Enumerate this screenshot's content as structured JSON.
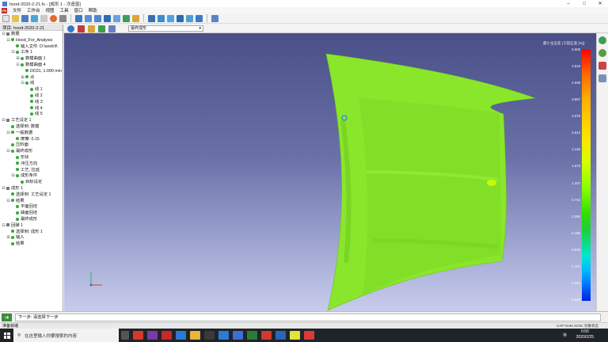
{
  "window": {
    "title": "hood-2020-2-21.fs - [成形 1 - 次造窗]"
  },
  "menu": {
    "logo": "FS",
    "items": [
      "文件",
      "工作台",
      "视图",
      "工具",
      "窗口",
      "帮助"
    ]
  },
  "panel": {
    "header": "项目: hood-2020-2-21",
    "tree": [
      {
        "label": "数据",
        "depth": 0,
        "tw": "⊟",
        "icon": "sq"
      },
      {
        "label": "Hood_For_Analysis",
        "depth": 1,
        "tw": "⊟",
        "icon": "dot"
      },
      {
        "label": "输入文件: D:\\work\\f\\",
        "depth": 2,
        "tw": "",
        "icon": "dot"
      },
      {
        "label": "工序 1",
        "depth": 2,
        "tw": "⊟",
        "icon": "dot"
      },
      {
        "label": "数模曲面 1",
        "depth": 3,
        "tw": "⊞",
        "icon": "dot"
      },
      {
        "label": "数模曲面 4",
        "depth": 3,
        "tw": "⊟",
        "icon": "dot"
      },
      {
        "label": "DC01, 1.000 mm",
        "depth": 4,
        "tw": "",
        "icon": "dot"
      },
      {
        "label": "点",
        "depth": 4,
        "tw": "⊞",
        "icon": "dot"
      },
      {
        "label": "线",
        "depth": 4,
        "tw": "⊟",
        "icon": "dot"
      },
      {
        "label": "线 1",
        "depth": 5,
        "tw": "",
        "icon": "dot"
      },
      {
        "label": "线 2",
        "depth": 5,
        "tw": "",
        "icon": "dot"
      },
      {
        "label": "线 3",
        "depth": 5,
        "tw": "",
        "icon": "dot"
      },
      {
        "label": "线 4",
        "depth": 5,
        "tw": "",
        "icon": "dot"
      },
      {
        "label": "线 5",
        "depth": 5,
        "tw": "",
        "icon": "dot"
      },
      {
        "label": "工艺设定 1",
        "depth": 0,
        "tw": "⊟",
        "icon": "sq"
      },
      {
        "label": "选择到: 数模",
        "depth": 1,
        "tw": "",
        "icon": "dot"
      },
      {
        "label": "一般数据",
        "depth": 1,
        "tw": "⊟",
        "icon": "dot"
      },
      {
        "label": "摩擦: 0.15",
        "depth": 2,
        "tw": "",
        "icon": "dot"
      },
      {
        "label": "压料面",
        "depth": 1,
        "tw": "",
        "icon": "dot"
      },
      {
        "label": "最终成形",
        "depth": 1,
        "tw": "⊟",
        "icon": "dot"
      },
      {
        "label": "形状",
        "depth": 2,
        "tw": "",
        "icon": "dot"
      },
      {
        "label": "冲压方向",
        "depth": 2,
        "tw": "",
        "icon": "dot"
      },
      {
        "label": "工艺, 拉延",
        "depth": 2,
        "tw": "",
        "icon": "dot"
      },
      {
        "label": "成形条件",
        "depth": 2,
        "tw": "⊟",
        "icon": "dot"
      },
      {
        "label": "目标设定",
        "depth": 3,
        "tw": "",
        "icon": "dot"
      },
      {
        "label": "成形 1",
        "depth": 0,
        "tw": "⊟",
        "icon": "sq"
      },
      {
        "label": "选择到: 工艺设定 1",
        "depth": 1,
        "tw": "",
        "icon": "dot"
      },
      {
        "label": "结果",
        "depth": 1,
        "tw": "⊟",
        "icon": "dot"
      },
      {
        "label": "平面回坯",
        "depth": 2,
        "tw": "",
        "icon": "dot"
      },
      {
        "label": "曲面回坯",
        "depth": 2,
        "tw": "",
        "icon": "dot"
      },
      {
        "label": "最终成形",
        "depth": 2,
        "tw": "",
        "icon": "dot"
      },
      {
        "label": "回弹 1",
        "depth": 0,
        "tw": "⊟",
        "icon": "sq"
      },
      {
        "label": "选择到: 成形 1",
        "depth": 1,
        "tw": "",
        "icon": "dot"
      },
      {
        "label": "输入",
        "depth": 1,
        "tw": "⊞",
        "icon": "dot"
      },
      {
        "label": "结果",
        "depth": 1,
        "tw": "",
        "icon": "dot"
      }
    ]
  },
  "view": {
    "result_select": "最终成形"
  },
  "legend": {
    "title": "最小主应变 (工程应变 [%])",
    "ticks": [
      "5.000",
      "4.519",
      "4.038",
      "3.557",
      "3.076",
      "2.613",
      "2.145",
      "1.673",
      "1.207",
      "0.742",
      "0.280",
      "-0.180",
      "-0.640",
      "-1.101",
      "-1.561",
      "-2.020"
    ]
  },
  "command": {
    "text": "下一步: 请选择下一步"
  },
  "status": {
    "text": "准备就绪",
    "indicators": "CAP NUM SCRL 对象状态"
  },
  "taskbar": {
    "search_placeholder": "在这里输入你要搜索的内容",
    "time": "0:50",
    "date": "2020/2/25",
    "lang": "英"
  },
  "colors": {
    "part": "#8ae62a",
    "viewport_top": "#4a4f88",
    "viewport_bottom": "#c8cceb"
  }
}
